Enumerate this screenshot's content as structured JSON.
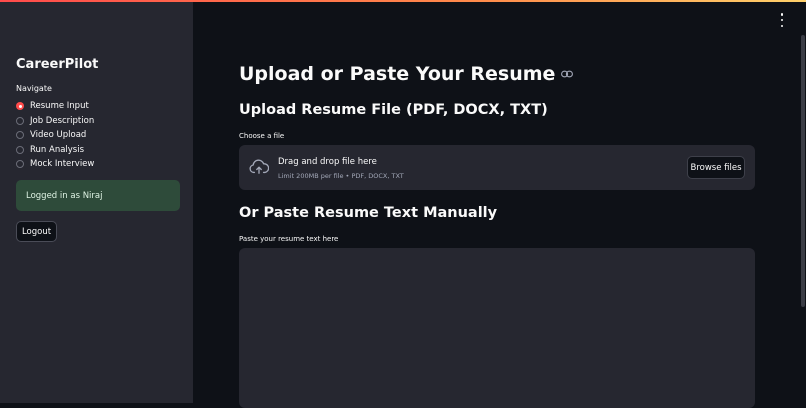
{
  "app": {
    "name": "CareerPilot"
  },
  "sidebar": {
    "nav_label": "Navigate",
    "items": [
      {
        "label": "Resume Input",
        "selected": true
      },
      {
        "label": "Job Description",
        "selected": false
      },
      {
        "label": "Video Upload",
        "selected": false
      },
      {
        "label": "Run Analysis",
        "selected": false
      },
      {
        "label": "Mock Interview",
        "selected": false
      }
    ],
    "login_status": "Logged in as Niraj",
    "logout_label": "Logout"
  },
  "main": {
    "title": "Upload or Paste Your Resume",
    "upload_section": {
      "heading": "Upload Resume File (PDF, DOCX, TXT)",
      "field_label": "Choose a file",
      "drop_title": "Drag and drop file here",
      "drop_limit": "Limit 200MB per file • PDF, DOCX, TXT",
      "browse_label": "Browse files"
    },
    "paste_section": {
      "heading": "Or Paste Resume Text Manually",
      "field_label": "Paste your resume text here",
      "value": ""
    }
  },
  "colors": {
    "background": "#0e1117",
    "sidebar": "#262730",
    "accent": "#ff4b4b",
    "success_box": "#2e4b3a"
  },
  "icons": {
    "menu": "vertical-ellipsis-icon",
    "anchor": "link-icon",
    "upload": "cloud-upload-icon"
  }
}
